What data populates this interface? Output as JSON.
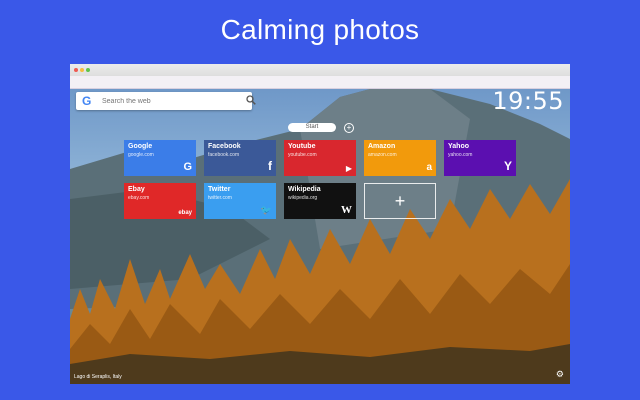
{
  "headline": "Calming photos",
  "search": {
    "logo": "G",
    "placeholder": "Search the web",
    "icon": "search-icon"
  },
  "clock": "19:55",
  "start": {
    "label": "Start",
    "add_symbol": "+"
  },
  "tiles": [
    {
      "name": "Google",
      "url": "google.com",
      "color": "#3b7de8",
      "logo": "G"
    },
    {
      "name": "Facebook",
      "url": "facebook.com",
      "color": "#3b5998",
      "logo": "f"
    },
    {
      "name": "Youtube",
      "url": "youtube.com",
      "color": "#d9272e",
      "logo": "▶"
    },
    {
      "name": "Amazon",
      "url": "amazon.com",
      "color": "#f29a0c",
      "logo": "a"
    },
    {
      "name": "Yahoo",
      "url": "yahoo.com",
      "color": "#5b0fb0",
      "logo": "Y"
    },
    {
      "name": "Ebay",
      "url": "ebay.com",
      "color": "#e02828",
      "logo": "ebay"
    },
    {
      "name": "Twitter",
      "url": "twitter.com",
      "color": "#3a9ef0",
      "logo": "🐦"
    },
    {
      "name": "Wikipedia",
      "url": "wikipedia.org",
      "color": "#111111",
      "logo": "W"
    }
  ],
  "add_tile": "+",
  "caption": "Lago di Seraplis, Italy",
  "settings_icon": "gear-icon"
}
